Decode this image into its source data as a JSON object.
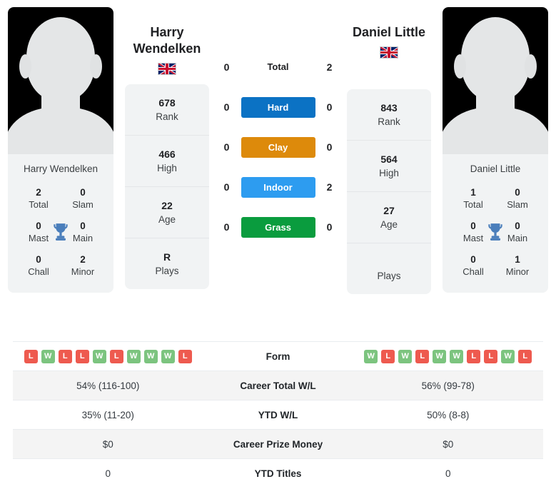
{
  "players": {
    "left": {
      "name": "Harry Wendelken",
      "name_line1": "Harry",
      "name_line2": "Wendelken",
      "photo_caption": "Harry Wendelken",
      "flag": "gb-flag",
      "titles": {
        "total": "2",
        "total_label": "Total",
        "slam": "0",
        "slam_label": "Slam",
        "mast": "0",
        "mast_label": "Mast",
        "main": "0",
        "main_label": "Main",
        "chall": "0",
        "chall_label": "Chall",
        "minor": "2",
        "minor_label": "Minor"
      },
      "info": [
        {
          "value": "678",
          "label": "Rank"
        },
        {
          "value": "466",
          "label": "High"
        },
        {
          "value": "22",
          "label": "Age"
        },
        {
          "value": "R",
          "label": "Plays"
        }
      ]
    },
    "right": {
      "name": "Daniel Little",
      "photo_caption": "Daniel Little",
      "flag": "gb-flag",
      "titles": {
        "total": "1",
        "total_label": "Total",
        "slam": "0",
        "slam_label": "Slam",
        "mast": "0",
        "mast_label": "Mast",
        "main": "0",
        "main_label": "Main",
        "chall": "0",
        "chall_label": "Chall",
        "minor": "1",
        "minor_label": "Minor"
      },
      "info": [
        {
          "value": "843",
          "label": "Rank"
        },
        {
          "value": "564",
          "label": "High"
        },
        {
          "value": "27",
          "label": "Age"
        },
        {
          "value": "",
          "label": "Plays"
        }
      ]
    }
  },
  "h2h": {
    "rows": [
      {
        "left": "0",
        "label": "Total",
        "right": "2",
        "style": "plain",
        "color": ""
      },
      {
        "left": "0",
        "label": "Hard",
        "right": "0",
        "style": "button",
        "color": "#0b72c4"
      },
      {
        "left": "0",
        "label": "Clay",
        "right": "0",
        "style": "button",
        "color": "#dd8a0b"
      },
      {
        "left": "0",
        "label": "Indoor",
        "right": "2",
        "style": "button",
        "color": "#2d9cf0"
      },
      {
        "left": "0",
        "label": "Grass",
        "right": "0",
        "style": "button",
        "color": "#0a9c3e"
      }
    ]
  },
  "stats_table": {
    "rows": [
      {
        "label": "Form",
        "type": "form",
        "left_form": [
          "L",
          "W",
          "L",
          "L",
          "W",
          "L",
          "W",
          "W",
          "W",
          "L"
        ],
        "right_form": [
          "W",
          "L",
          "W",
          "L",
          "W",
          "W",
          "L",
          "L",
          "W",
          "L"
        ],
        "left": "",
        "right": "",
        "alt": false
      },
      {
        "label": "Career Total W/L",
        "type": "text",
        "left": "54% (116-100)",
        "right": "56% (99-78)",
        "alt": true
      },
      {
        "label": "YTD W/L",
        "type": "text",
        "left": "35% (11-20)",
        "right": "50% (8-8)",
        "alt": false
      },
      {
        "label": "Career Prize Money",
        "type": "text",
        "left": "$0",
        "right": "$0",
        "alt": true
      },
      {
        "label": "YTD Titles",
        "type": "text",
        "left": "0",
        "right": "0",
        "alt": false
      }
    ]
  },
  "colors": {
    "hard": "#0b72c4",
    "clay": "#dd8a0b",
    "indoor": "#2d9cf0",
    "grass": "#0a9c3e",
    "win_badge": "#7cc47f",
    "loss_badge": "#ee5a4f",
    "card_bg": "#f1f3f4"
  }
}
